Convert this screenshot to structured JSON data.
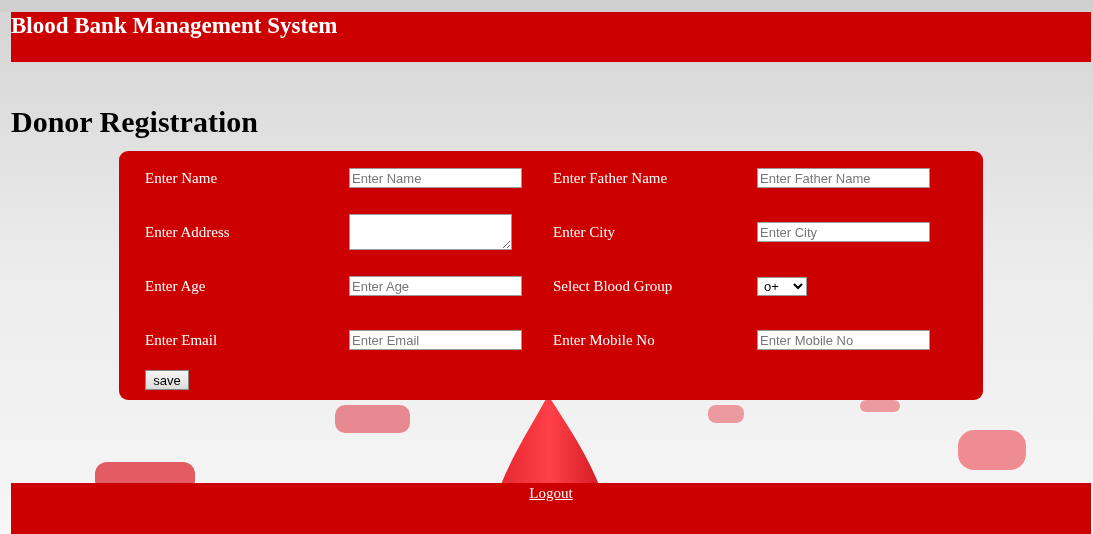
{
  "header": {
    "title": "Blood Bank Management System"
  },
  "page_title": "Donor Registration",
  "form": {
    "fields": [
      {
        "label": "Enter Name",
        "kind": "text",
        "placeholder": "Enter Name"
      },
      {
        "label": "Enter Father Name",
        "kind": "text",
        "placeholder": "Enter Father Name"
      },
      {
        "label": "Enter Address",
        "kind": "textarea"
      },
      {
        "label": "Enter City",
        "kind": "text",
        "placeholder": "Enter City"
      },
      {
        "label": "Enter Age",
        "kind": "text",
        "placeholder": "Enter Age"
      },
      {
        "label": "Select Blood Group",
        "kind": "select",
        "value": "o+"
      },
      {
        "label": "Enter Email",
        "kind": "text",
        "placeholder": "Enter Email"
      },
      {
        "label": "Enter Mobile No",
        "kind": "text",
        "placeholder": "Enter Mobile No"
      }
    ],
    "button": "save"
  },
  "footer": {
    "link": "Logout"
  }
}
